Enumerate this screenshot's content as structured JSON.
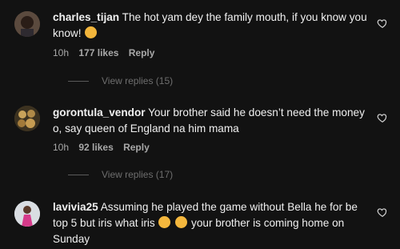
{
  "comments": [
    {
      "username": "charles_tijan",
      "text": "The hot yam dey the family mouth, if you know you know!",
      "emoji": "pensive-face",
      "time": "10h",
      "likes": "177 likes",
      "reply": "Reply",
      "view_replies": "View replies (15)"
    },
    {
      "username": "gorontula_vendor",
      "text": "Your brother said he doesn’t need the money o, say queen of England na him mama",
      "time": "10h",
      "likes": "92 likes",
      "reply": "Reply",
      "view_replies": "View replies (17)"
    },
    {
      "username": "lavivia25",
      "text_part1": "Assuming he played the game without Bella he for be top 5 but iris what iris",
      "emojis": [
        "grinning-sweat-face",
        "grinning-sweat-face"
      ],
      "text_part2": "your brother is coming home on Sunday"
    }
  ],
  "colors": {
    "background": "#121212",
    "text": "#f5f5f5",
    "meta": "#a8a8a8",
    "muted": "#6e6e6e"
  }
}
